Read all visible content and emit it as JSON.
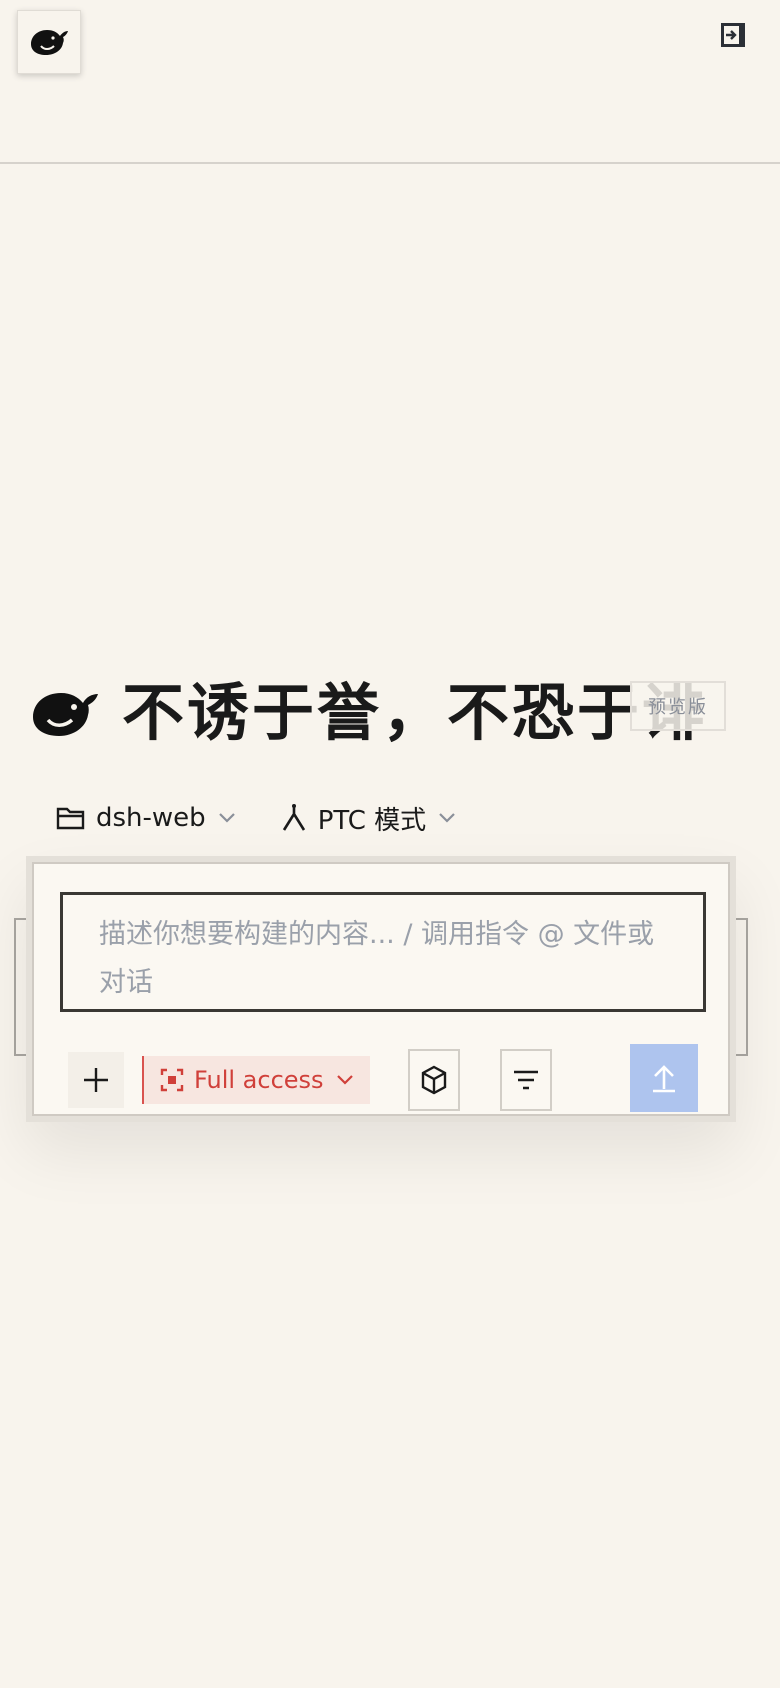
{
  "header": {
    "logo_icon": "whale-logo-icon",
    "expand_icon": "sidebar-expand-icon"
  },
  "hero": {
    "title": "不诱于誉，不恐于诽",
    "badge": "预览版",
    "logo_icon": "whale-logo-icon"
  },
  "selectors": {
    "project": {
      "label": "dsh-web",
      "icon": "folder-icon"
    },
    "mode": {
      "label": "PTC 模式",
      "icon": "branch-icon"
    }
  },
  "composer": {
    "placeholder": "描述你想要构建的内容... / 调用指令 @ 文件或对话",
    "access_label": "Full access",
    "add_icon": "plus-icon",
    "cube_icon": "cube-icon",
    "filter_icon": "filter-icon",
    "send_icon": "arrow-up-icon"
  },
  "colors": {
    "background": "#f8f4ed",
    "access_red": "#d0403a",
    "send_blue": "#aec4ee",
    "text_dark": "#1a1a1a",
    "placeholder_gray": "#9aa0aa"
  }
}
